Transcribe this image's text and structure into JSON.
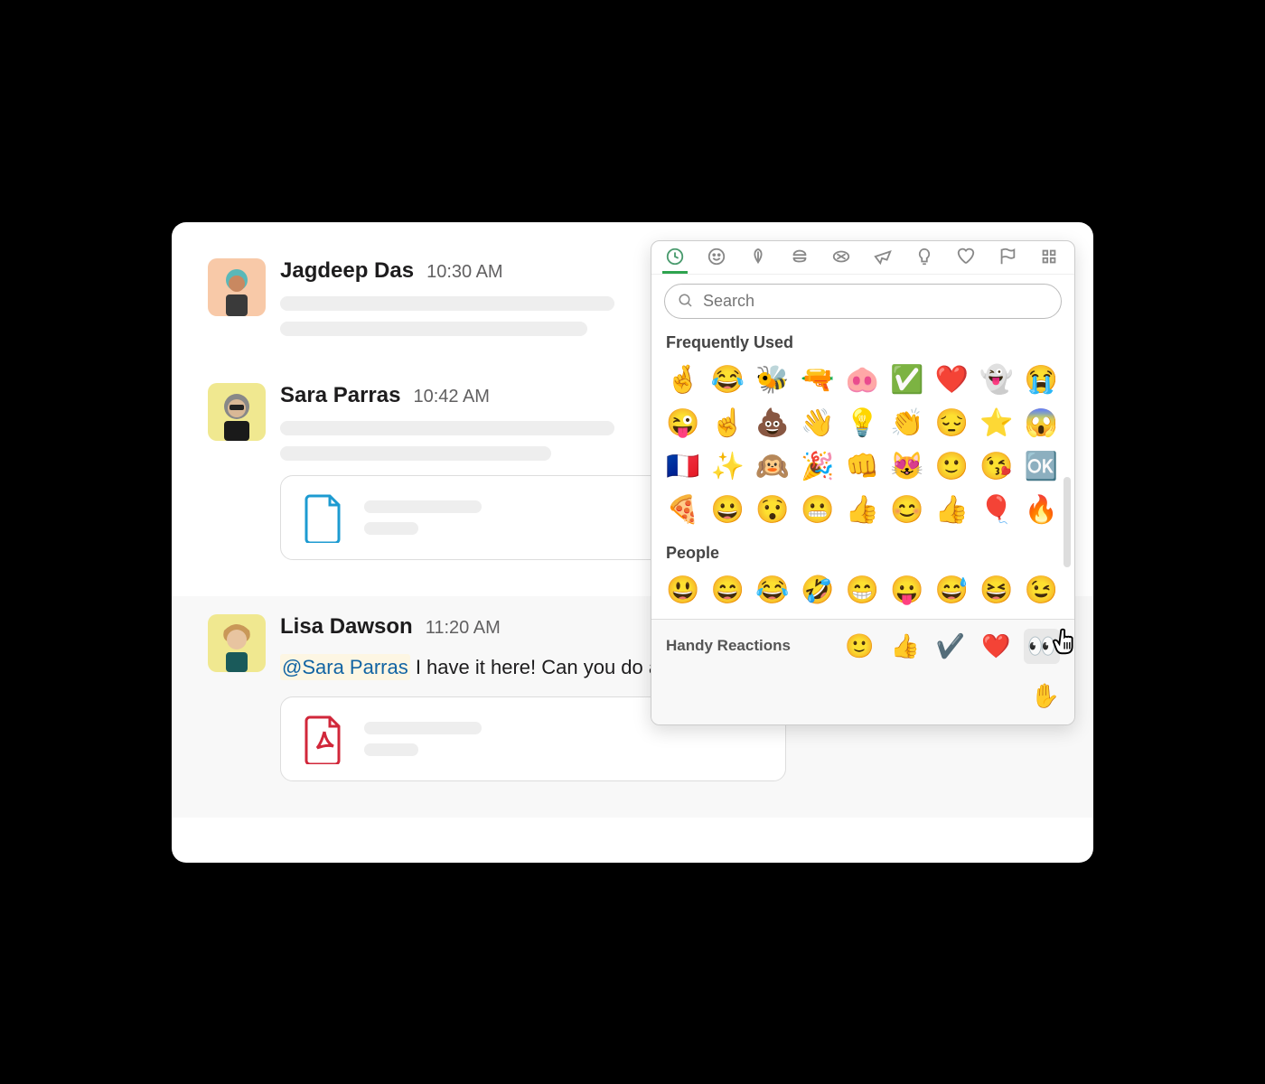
{
  "messages": [
    {
      "sender": "Jagdeep Das",
      "time": "10:30 AM"
    },
    {
      "sender": "Sara Parras",
      "time": "10:42 AM"
    },
    {
      "sender": "Lisa Dawson",
      "time": "11:20 AM",
      "mention": "@Sara Parras",
      "text": " I have it here! Can you do a quick review?"
    }
  ],
  "emoji_picker": {
    "search_placeholder": "Search",
    "sections": {
      "frequent": {
        "label": "Frequently Used",
        "emojis": [
          "🤞",
          "😂",
          "🐝",
          "🔫",
          "🐽",
          "✅",
          "❤️",
          "👻",
          "😭",
          "😜",
          "☝️",
          "💩",
          "👋",
          "💡",
          "👏",
          "😔",
          "⭐",
          "😱",
          "🇫🇷",
          "✨",
          "🙉",
          "🎉",
          "👊",
          "😻",
          "🙂",
          "😘",
          "🆗",
          "🍕",
          "😀",
          "😯",
          "😬",
          "👍",
          "😊",
          "👍",
          "🎈",
          "🔥"
        ]
      },
      "people": {
        "label": "People",
        "emojis": [
          "😃",
          "😄",
          "😂",
          "🤣",
          "😁",
          "😛",
          "😅",
          "😆",
          "😉"
        ]
      }
    },
    "handy": {
      "label": "Handy Reactions",
      "emojis": [
        "🙂",
        "👍",
        "✔️",
        "❤️",
        "👀"
      ]
    },
    "skin_tone": "✋"
  }
}
